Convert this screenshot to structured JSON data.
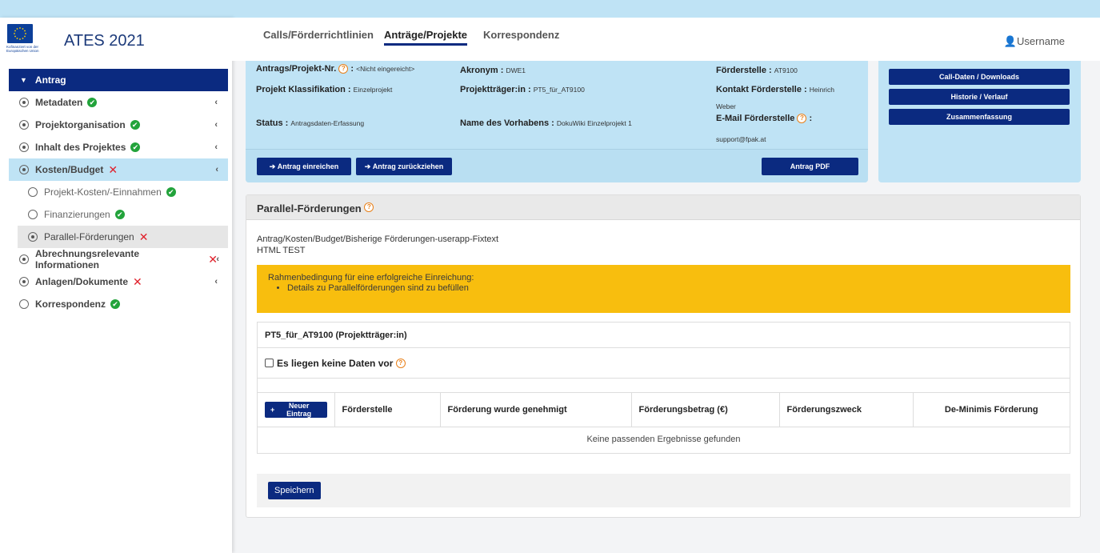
{
  "brand": {
    "title": "ATES 2021",
    "logo_text_1": "Kofinanziert von der",
    "logo_text_2": "Europäischen Union"
  },
  "topnav": {
    "tabs": [
      {
        "label": "Calls/Förderrichtlinien",
        "active": false
      },
      {
        "label": "Anträge/Projekte",
        "active": true
      },
      {
        "label": "Korrespondenz",
        "active": false
      }
    ],
    "user": "Username"
  },
  "sidebar": {
    "header": "Antrag",
    "items": [
      {
        "label": "Metadaten",
        "status": "ok",
        "expandable": true
      },
      {
        "label": "Projektorganisation",
        "status": "ok",
        "expandable": true
      },
      {
        "label": "Inhalt des Projektes",
        "status": "ok",
        "expandable": true
      },
      {
        "label": "Kosten/Budget",
        "status": "error",
        "expandable": true,
        "active": true
      },
      {
        "label": "Projekt-Kosten/-Einnahmen",
        "status": "ok",
        "sub": true
      },
      {
        "label": "Finanzierungen",
        "status": "ok",
        "sub": true
      },
      {
        "label": "Parallel-Förderungen",
        "status": "error",
        "sub": true,
        "selected": true
      },
      {
        "label": "Abrechnungsrelevante Informationen",
        "status": "error",
        "expandable": true
      },
      {
        "label": "Anlagen/Dokumente",
        "status": "error",
        "expandable": true
      },
      {
        "label": "Korrespondenz",
        "status": "ok",
        "expandable": false
      }
    ]
  },
  "project": {
    "nr_label": "Antrags/Projekt-Nr.",
    "nr_value": "<Nicht eingereicht>",
    "klass_label": "Projekt Klassifikation :",
    "klass_value": "Einzelprojekt",
    "status_label": "Status :",
    "status_value": "Antragsdaten-Erfassung",
    "akronym_label": "Akronym :",
    "akronym_value": "DWE1",
    "traeger_label": "Projektträger:in :",
    "traeger_value": "PT5_für_AT9100",
    "vorhaben_label": "Name des Vorhabens :",
    "vorhaben_value": "DokuWiki Einzelprojekt 1",
    "foerderstelle_label": "Förderstelle :",
    "foerderstelle_value": "AT9100",
    "kontakt_label": "Kontakt Förderstelle :",
    "kontakt_value_1": "Heinrich",
    "kontakt_value_2": "Weber",
    "email_label": "E-Mail Förderstelle",
    "email_value": "support@fpak.at",
    "btn_einreichen": "Antrag einreichen",
    "btn_zurueckziehen": "Antrag zurückziehen",
    "btn_pdf": "Antrag PDF"
  },
  "side_buttons": {
    "call_daten": "Call-Daten / Downloads",
    "historie": "Historie / Verlauf",
    "zusammenfassung": "Zusammenfassung"
  },
  "main": {
    "title": "Parallel-Förderungen",
    "text_1": "Antrag/Kosten/Budget/Bisherige Förderungen-userapp-Fixtext",
    "text_2": "HTML TEST",
    "warning_title": "Rahmenbedingung für eine erfolgreiche Einreichung:",
    "warning_items": [
      "Details zu Parallelförderungen sind zu befüllen"
    ],
    "table_title": "PT5_für_AT9100 (Projektträger:in)",
    "checkbox_label": "Es liegen keine Daten vor",
    "btn_new": "Neuer Eintrag",
    "columns": [
      "Förderstelle",
      "Förderung wurde genehmigt",
      "Förderungsbetrag (€)",
      "Förderungszweck",
      "De-Minimis Förderung"
    ],
    "empty_text": "Keine passenden Ergebnisse gefunden",
    "btn_save": "Speichern"
  },
  "colors": {
    "brand_navy": "#0b2a80",
    "info_blue": "#bfe3f5",
    "warning_yellow": "#f8be0e",
    "ok_green": "#22a33b",
    "error_red": "#e0202b",
    "help_orange": "#e8801a"
  }
}
